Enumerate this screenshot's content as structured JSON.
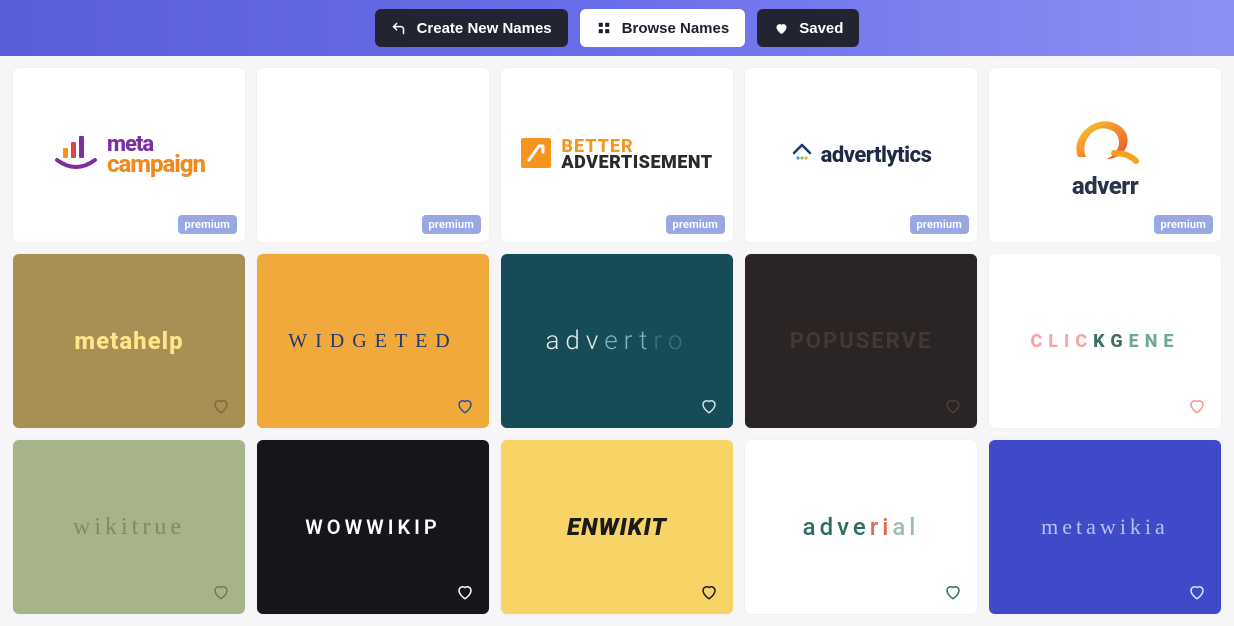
{
  "topbar": {
    "create": "Create New Names",
    "browse": "Browse Names",
    "saved": "Saved"
  },
  "badges": {
    "premium": "premium"
  },
  "cards": [
    {
      "id": "metacampaign",
      "premium": true,
      "text1": "meta",
      "text2": "campaign"
    },
    {
      "id": "blank",
      "premium": true
    },
    {
      "id": "betterad",
      "premium": true,
      "text1": "BETTER",
      "text2": "ADVERTISEMENT"
    },
    {
      "id": "advertlytics",
      "premium": true,
      "text1": "advertlytics"
    },
    {
      "id": "adverr",
      "premium": true,
      "text1": "adverr"
    },
    {
      "id": "metahelp",
      "heart": true,
      "heartColor": "#7d6a3c",
      "text1": "metahelp"
    },
    {
      "id": "widgeted",
      "heart": true,
      "heartColor": "#2b4f97",
      "text1": "WIDGETED"
    },
    {
      "id": "advertro",
      "heart": true,
      "heartColor": "#cfe3e6",
      "text1": "adv",
      "text2": "ert",
      "text3": "ro"
    },
    {
      "id": "popuserve",
      "heart": true,
      "heartColor": "#4a3e3e",
      "text1": "POPUSERVE"
    },
    {
      "id": "clickgene",
      "heart": true,
      "heartColor": "#f59a8e",
      "text1": "CLIC",
      "text2": "KG",
      "text3": "ENE"
    },
    {
      "id": "wikitrue",
      "heart": true,
      "heartColor": "#6f7a57",
      "text1": "wikitrue"
    },
    {
      "id": "wowwikip",
      "heart": true,
      "heartColor": "#ffffff",
      "text1": "WOWWIKIP"
    },
    {
      "id": "enwikit",
      "heart": true,
      "heartColor": "#1b1b1b",
      "text1": "ENWIKIT"
    },
    {
      "id": "adverial",
      "heart": true,
      "heartColor": "#2b6d63",
      "text1": "adve",
      "text2": "ri",
      "text3": "al"
    },
    {
      "id": "metawikia",
      "heart": true,
      "heartColor": "#dfe2ff",
      "text1": "metawikia"
    }
  ]
}
